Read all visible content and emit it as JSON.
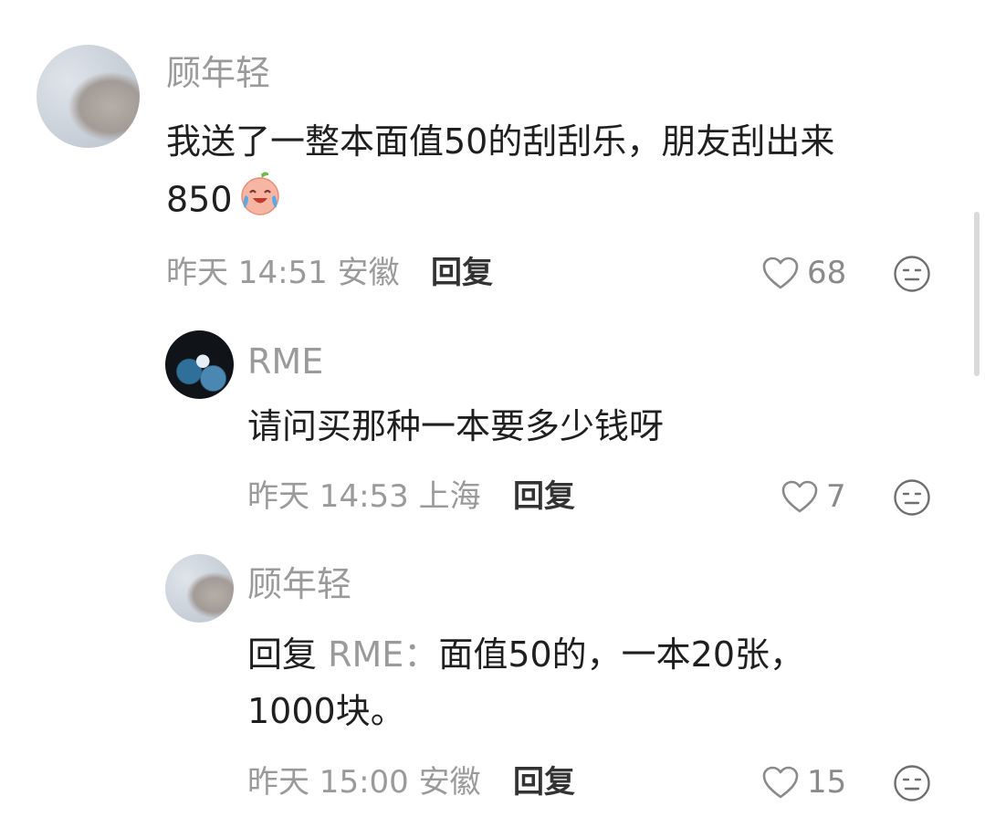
{
  "comments": [
    {
      "user": "顾年轻",
      "text_line1": "我送了一整本面值50的刮刮乐，朋友刮出来",
      "text_line2": "850",
      "emoji": "crying-laughing-peach-emoji",
      "time": "昨天 14:51 安徽",
      "reply_label": "回复",
      "likes": "68"
    },
    {
      "user": "RME",
      "text": "请问买那种一本要多少钱呀",
      "time": "昨天 14:53 上海",
      "reply_label": "回复",
      "likes": "7"
    },
    {
      "user": "顾年轻",
      "reply_prefix": "回复",
      "reply_to": "RME：",
      "text_line1": "面值50的，一本20张，",
      "text_line2": "1000块。",
      "time": "昨天 15:00 安徽",
      "reply_label": "回复",
      "likes": "15"
    }
  ],
  "icons": {
    "like": "heart-outline-icon",
    "dislike": "neutral-face-icon"
  },
  "colors": {
    "primary_text": "#1f1f1f",
    "secondary_text": "#9a9a9a",
    "action_text": "#333333"
  }
}
